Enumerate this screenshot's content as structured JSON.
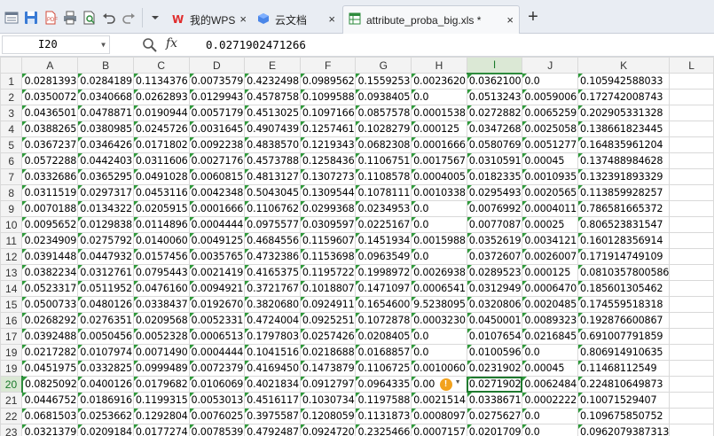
{
  "tabs": [
    {
      "label": "我的WPS",
      "icon": "wps-logo-icon"
    },
    {
      "label": "云文档",
      "icon": "cloud-cube-icon"
    },
    {
      "label": "attribute_proba_big.xls *",
      "icon": "spreadsheet-icon",
      "active": true
    }
  ],
  "formula_bar": {
    "cell_ref": "I20",
    "fx_label": "fx",
    "value": "0.0271902471266"
  },
  "columns": [
    "A",
    "B",
    "C",
    "D",
    "E",
    "F",
    "G",
    "H",
    "I",
    "J",
    "K",
    "L"
  ],
  "selected_column": "I",
  "selected_row": "20",
  "rows": [
    {
      "num": "1",
      "cells": [
        "0.0281393",
        "0.0284189",
        "0.1134376",
        "0.0073579",
        "0.4232498",
        "0.0989562",
        "0.1559253",
        "0.0023620",
        "0.0362100",
        "0.0",
        "0.105942588033",
        ""
      ]
    },
    {
      "num": "2",
      "cells": [
        "0.0350072",
        "0.0340668",
        "0.0262893",
        "0.0129943",
        "0.4578758",
        "0.1099588",
        "0.0938405",
        "0.0",
        "0.0513243",
        "0.0059006",
        "0.172742008743",
        ""
      ]
    },
    {
      "num": "3",
      "cells": [
        "0.0436501",
        "0.0478871",
        "0.0190944",
        "0.0057179",
        "0.4513025",
        "0.1097166",
        "0.0857578",
        "0.0001538",
        "0.0272882",
        "0.0065259",
        "0.202905331328",
        ""
      ]
    },
    {
      "num": "4",
      "cells": [
        "0.0388265",
        "0.0380985",
        "0.0245726",
        "0.0031645",
        "0.4907439",
        "0.1257461",
        "0.1028279",
        "0.000125",
        "0.0347268",
        "0.0025058",
        "0.138661823445",
        ""
      ]
    },
    {
      "num": "5",
      "cells": [
        "0.0367237",
        "0.0346426",
        "0.0171802",
        "0.0092238",
        "0.4838570",
        "0.1219343",
        "0.0682308",
        "0.0001666",
        "0.0580769",
        "0.0051277",
        "0.164835961204",
        ""
      ]
    },
    {
      "num": "6",
      "cells": [
        "0.0572288",
        "0.0442403",
        "0.0311606",
        "0.0027176",
        "0.4573788",
        "0.1258436",
        "0.1106751",
        "0.0017567",
        "0.0310591",
        "0.00045",
        "0.137488984628",
        ""
      ]
    },
    {
      "num": "7",
      "cells": [
        "0.0332686",
        "0.0365295",
        "0.0491028",
        "0.0060815",
        "0.4813127",
        "0.1307273",
        "0.1108578",
        "0.0004005",
        "0.0182335",
        "0.0010935",
        "0.132391893329",
        ""
      ]
    },
    {
      "num": "8",
      "cells": [
        "0.0311519",
        "0.0297317",
        "0.0453116",
        "0.0042348",
        "0.5043045",
        "0.1309544",
        "0.1078111",
        "0.0010338",
        "0.0295493",
        "0.0020565",
        "0.113859928257",
        ""
      ]
    },
    {
      "num": "9",
      "cells": [
        "0.0070188",
        "0.0134322",
        "0.0205915",
        "0.0001666",
        "0.1106762",
        "0.0299368",
        "0.0234953",
        "0.0",
        "0.0076992",
        "0.0004011",
        "0.786581665372",
        ""
      ]
    },
    {
      "num": "10",
      "cells": [
        "0.0095652",
        "0.0129838",
        "0.0114896",
        "0.0004444",
        "0.0975577",
        "0.0309597",
        "0.0225167",
        "0.0",
        "0.0077087",
        "0.00025",
        "0.806523831547",
        ""
      ]
    },
    {
      "num": "11",
      "cells": [
        "0.0234909",
        "0.0275792",
        "0.0140060",
        "0.0049125",
        "0.4684556",
        "0.1159607",
        "0.1451934",
        "0.0015988",
        "0.0352619",
        "0.0034121",
        "0.160128356914",
        ""
      ]
    },
    {
      "num": "12",
      "cells": [
        "0.0391448",
        "0.0447932",
        "0.0157456",
        "0.0035765",
        "0.4732386",
        "0.1153698",
        "0.0963549",
        "0.0",
        "0.0372607",
        "0.0026007",
        "0.171914749109",
        ""
      ]
    },
    {
      "num": "13",
      "cells": [
        "0.0382234",
        "0.0312761",
        "0.0795443",
        "0.0021419",
        "0.4165375",
        "0.1195722",
        "0.1998972",
        "0.0026938",
        "0.0289523",
        "0.000125",
        "0.0810357800586",
        ""
      ]
    },
    {
      "num": "14",
      "cells": [
        "0.0523317",
        "0.0511952",
        "0.0476160",
        "0.0094921",
        "0.3721767",
        "0.1018807",
        "0.1471097",
        "0.0006541",
        "0.0312949",
        "0.0006470",
        "0.185601305462",
        ""
      ]
    },
    {
      "num": "15",
      "cells": [
        "0.0500733",
        "0.0480126",
        "0.0338437",
        "0.0192670",
        "0.3820680",
        "0.0924911",
        "0.1654600",
        "9.5238095",
        "0.0320806",
        "0.0020485",
        "0.174559518318",
        ""
      ]
    },
    {
      "num": "16",
      "cells": [
        "0.0268292",
        "0.0276351",
        "0.0209568",
        "0.0052331",
        "0.4724004",
        "0.0925251",
        "0.1072878",
        "0.0003230",
        "0.0450001",
        "0.0089323",
        "0.192876600867",
        ""
      ]
    },
    {
      "num": "17",
      "cells": [
        "0.0392488",
        "0.0050456",
        "0.0052328",
        "0.0006513",
        "0.1797803",
        "0.0257426",
        "0.0208405",
        "0.0",
        "0.0107654",
        "0.0216845",
        "0.691007791859",
        ""
      ]
    },
    {
      "num": "19",
      "cells": [
        "0.0217282",
        "0.0107974",
        "0.0071490",
        "0.0004444",
        "0.1041516",
        "0.0218688",
        "0.0168857",
        "0.0",
        "0.0100596",
        "0.0",
        "0.806914910635",
        ""
      ]
    },
    {
      "num": "19",
      "cells": [
        "0.0451975",
        "0.0332825",
        "0.0999489",
        "0.0072379",
        "0.4169450",
        "0.1473879",
        "0.1106725",
        "0.0010060",
        "0.0231902",
        "0.00045",
        "0.11468112549",
        ""
      ]
    },
    {
      "num": "20",
      "cells": [
        "0.0825092",
        "0.0400126",
        "0.0179682",
        "0.0106069",
        "0.4021834",
        "0.0912797",
        "0.0964335",
        "0.00",
        "0.0271902",
        "0.0062484",
        "0.224810649873",
        ""
      ]
    },
    {
      "num": "21",
      "cells": [
        "0.0446752",
        "0.0186916",
        "0.1199315",
        "0.0053013",
        "0.4516117",
        "0.1030734",
        "0.1197588",
        "0.0021514",
        "0.0338671",
        "0.0002222",
        "0.10071529407",
        ""
      ]
    },
    {
      "num": "22",
      "cells": [
        "0.0681503",
        "0.0253662",
        "0.1292804",
        "0.0076025",
        "0.3975587",
        "0.1208059",
        "0.1131873",
        "0.0008097",
        "0.0275627",
        "0.0",
        "0.109675850752",
        ""
      ]
    },
    {
      "num": "23",
      "cells": [
        "0.0321379",
        "0.0209184",
        "0.0177274",
        "0.0078539",
        "0.4792487",
        "0.0924720",
        "0.2325466",
        "0.0007157",
        "0.0201709",
        "0.0",
        "0.0962079387313",
        ""
      ]
    },
    {
      "num": "24",
      "cells": [
        "0.0245704",
        "0.0234590",
        "0.0584794",
        "0.0016896",
        "0.5386224",
        "0.0991902",
        "0.1238993",
        "0.0026194",
        "0.0323669",
        "0.0",
        "0.0951029444227",
        ""
      ]
    }
  ]
}
